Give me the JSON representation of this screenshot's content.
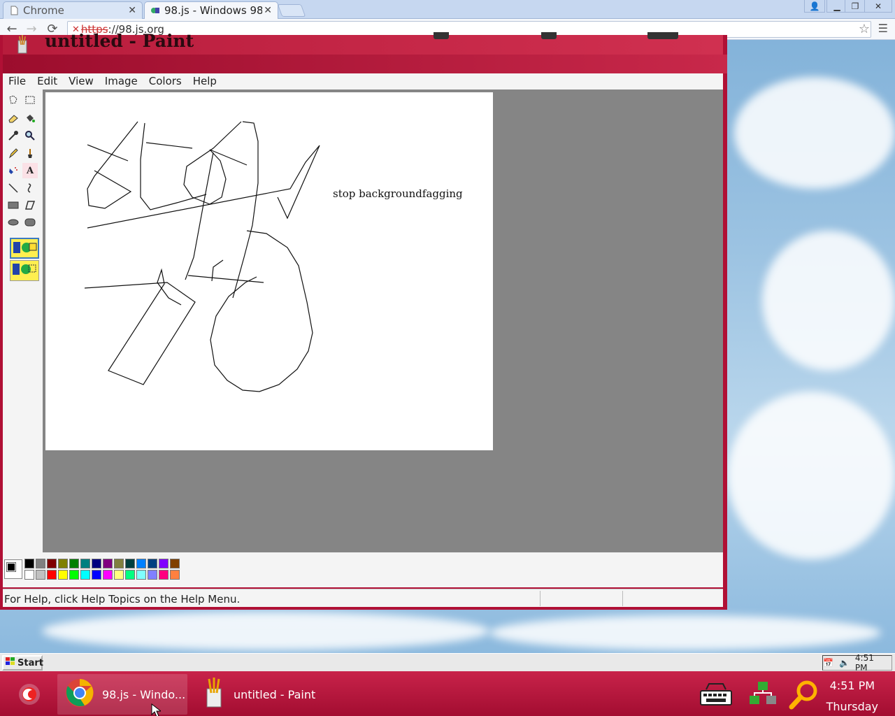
{
  "browser": {
    "tabs": [
      {
        "label": "Chrome",
        "active": false
      },
      {
        "label": "98.js - Windows 98",
        "active": true
      }
    ],
    "url_scheme": "https",
    "url_rest": "://98.js.org"
  },
  "paint": {
    "title": "untitled - Paint",
    "menu": [
      "File",
      "Edit",
      "View",
      "Image",
      "Colors",
      "Help"
    ],
    "canvas_text": "stop backgroundfagging",
    "status": "For Help, click Help Topics on the Help Menu.",
    "palette_top": [
      "#000000",
      "#808080",
      "#800000",
      "#808000",
      "#008000",
      "#008080",
      "#000080",
      "#800080",
      "#808040",
      "#004040",
      "#0080ff",
      "#004080",
      "#8000ff",
      "#804000"
    ],
    "palette_bottom": [
      "#ffffff",
      "#c0c0c0",
      "#ff0000",
      "#ffff00",
      "#00ff00",
      "#00ffff",
      "#0000ff",
      "#ff00ff",
      "#ffff80",
      "#00ff80",
      "#80ffff",
      "#8080ff",
      "#ff0080",
      "#ff8040"
    ]
  },
  "win98": {
    "start_label": "Start",
    "time": "4:51 PM"
  },
  "host": {
    "chrome_task": "98.js - Windo...",
    "paint_task": "untitled - Paint",
    "time": "4:51 PM",
    "day": "Thursday"
  }
}
